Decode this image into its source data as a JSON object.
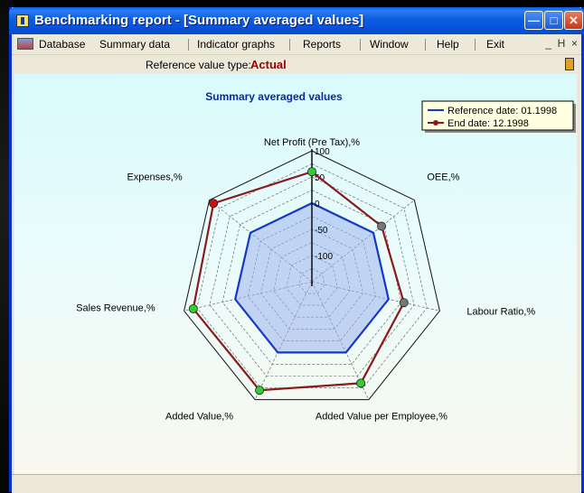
{
  "window": {
    "title": "Benchmarking report - [Summary averaged values]",
    "buttons": {
      "minimize": "—",
      "maximize": "□",
      "close": "✕"
    }
  },
  "menu": {
    "items": [
      "Database",
      "Summary data",
      "Indicator graphs",
      "Reports",
      "Window",
      "Help",
      "Exit"
    ],
    "mdi_controls": "_  Η  ×"
  },
  "reference": {
    "label": "Reference value type:",
    "value": "Actual"
  },
  "icons": [
    "app-icon",
    "database-icon",
    "exit-door-icon"
  ],
  "colors": {
    "reference_series": "#1538C8",
    "end_series": "#8B1A1A",
    "point_green": "#33CC33",
    "point_gray": "#777777",
    "area_fill": "#9DB3EE"
  },
  "chart_data": {
    "type": "radar",
    "title": "Summary averaged values",
    "axes": [
      "Net Profit (Pre Tax),%",
      "OEE,%",
      "Labour Ratio,%",
      "Added Value per Employee,%",
      "Added Value,%",
      "Sales Revenue,%",
      "Expenses,%"
    ],
    "scale": {
      "min": -150,
      "max": 100,
      "ticks": [
        100,
        50,
        0,
        -50,
        -100
      ]
    },
    "tick_labels": [
      "100",
      "50",
      "0",
      "-50",
      "-100"
    ],
    "grid": true,
    "legend_position": "top-right",
    "series": [
      {
        "name": "Reference date: 01.1998",
        "values": [
          0,
          0,
          0,
          0,
          0,
          0,
          0
        ]
      },
      {
        "name": "End date: 12.1998",
        "values": [
          60,
          20,
          30,
          65,
          80,
          82,
          90
        ],
        "point_colors": [
          "green",
          "gray",
          "gray",
          "green",
          "green",
          "green",
          "red"
        ]
      }
    ]
  }
}
